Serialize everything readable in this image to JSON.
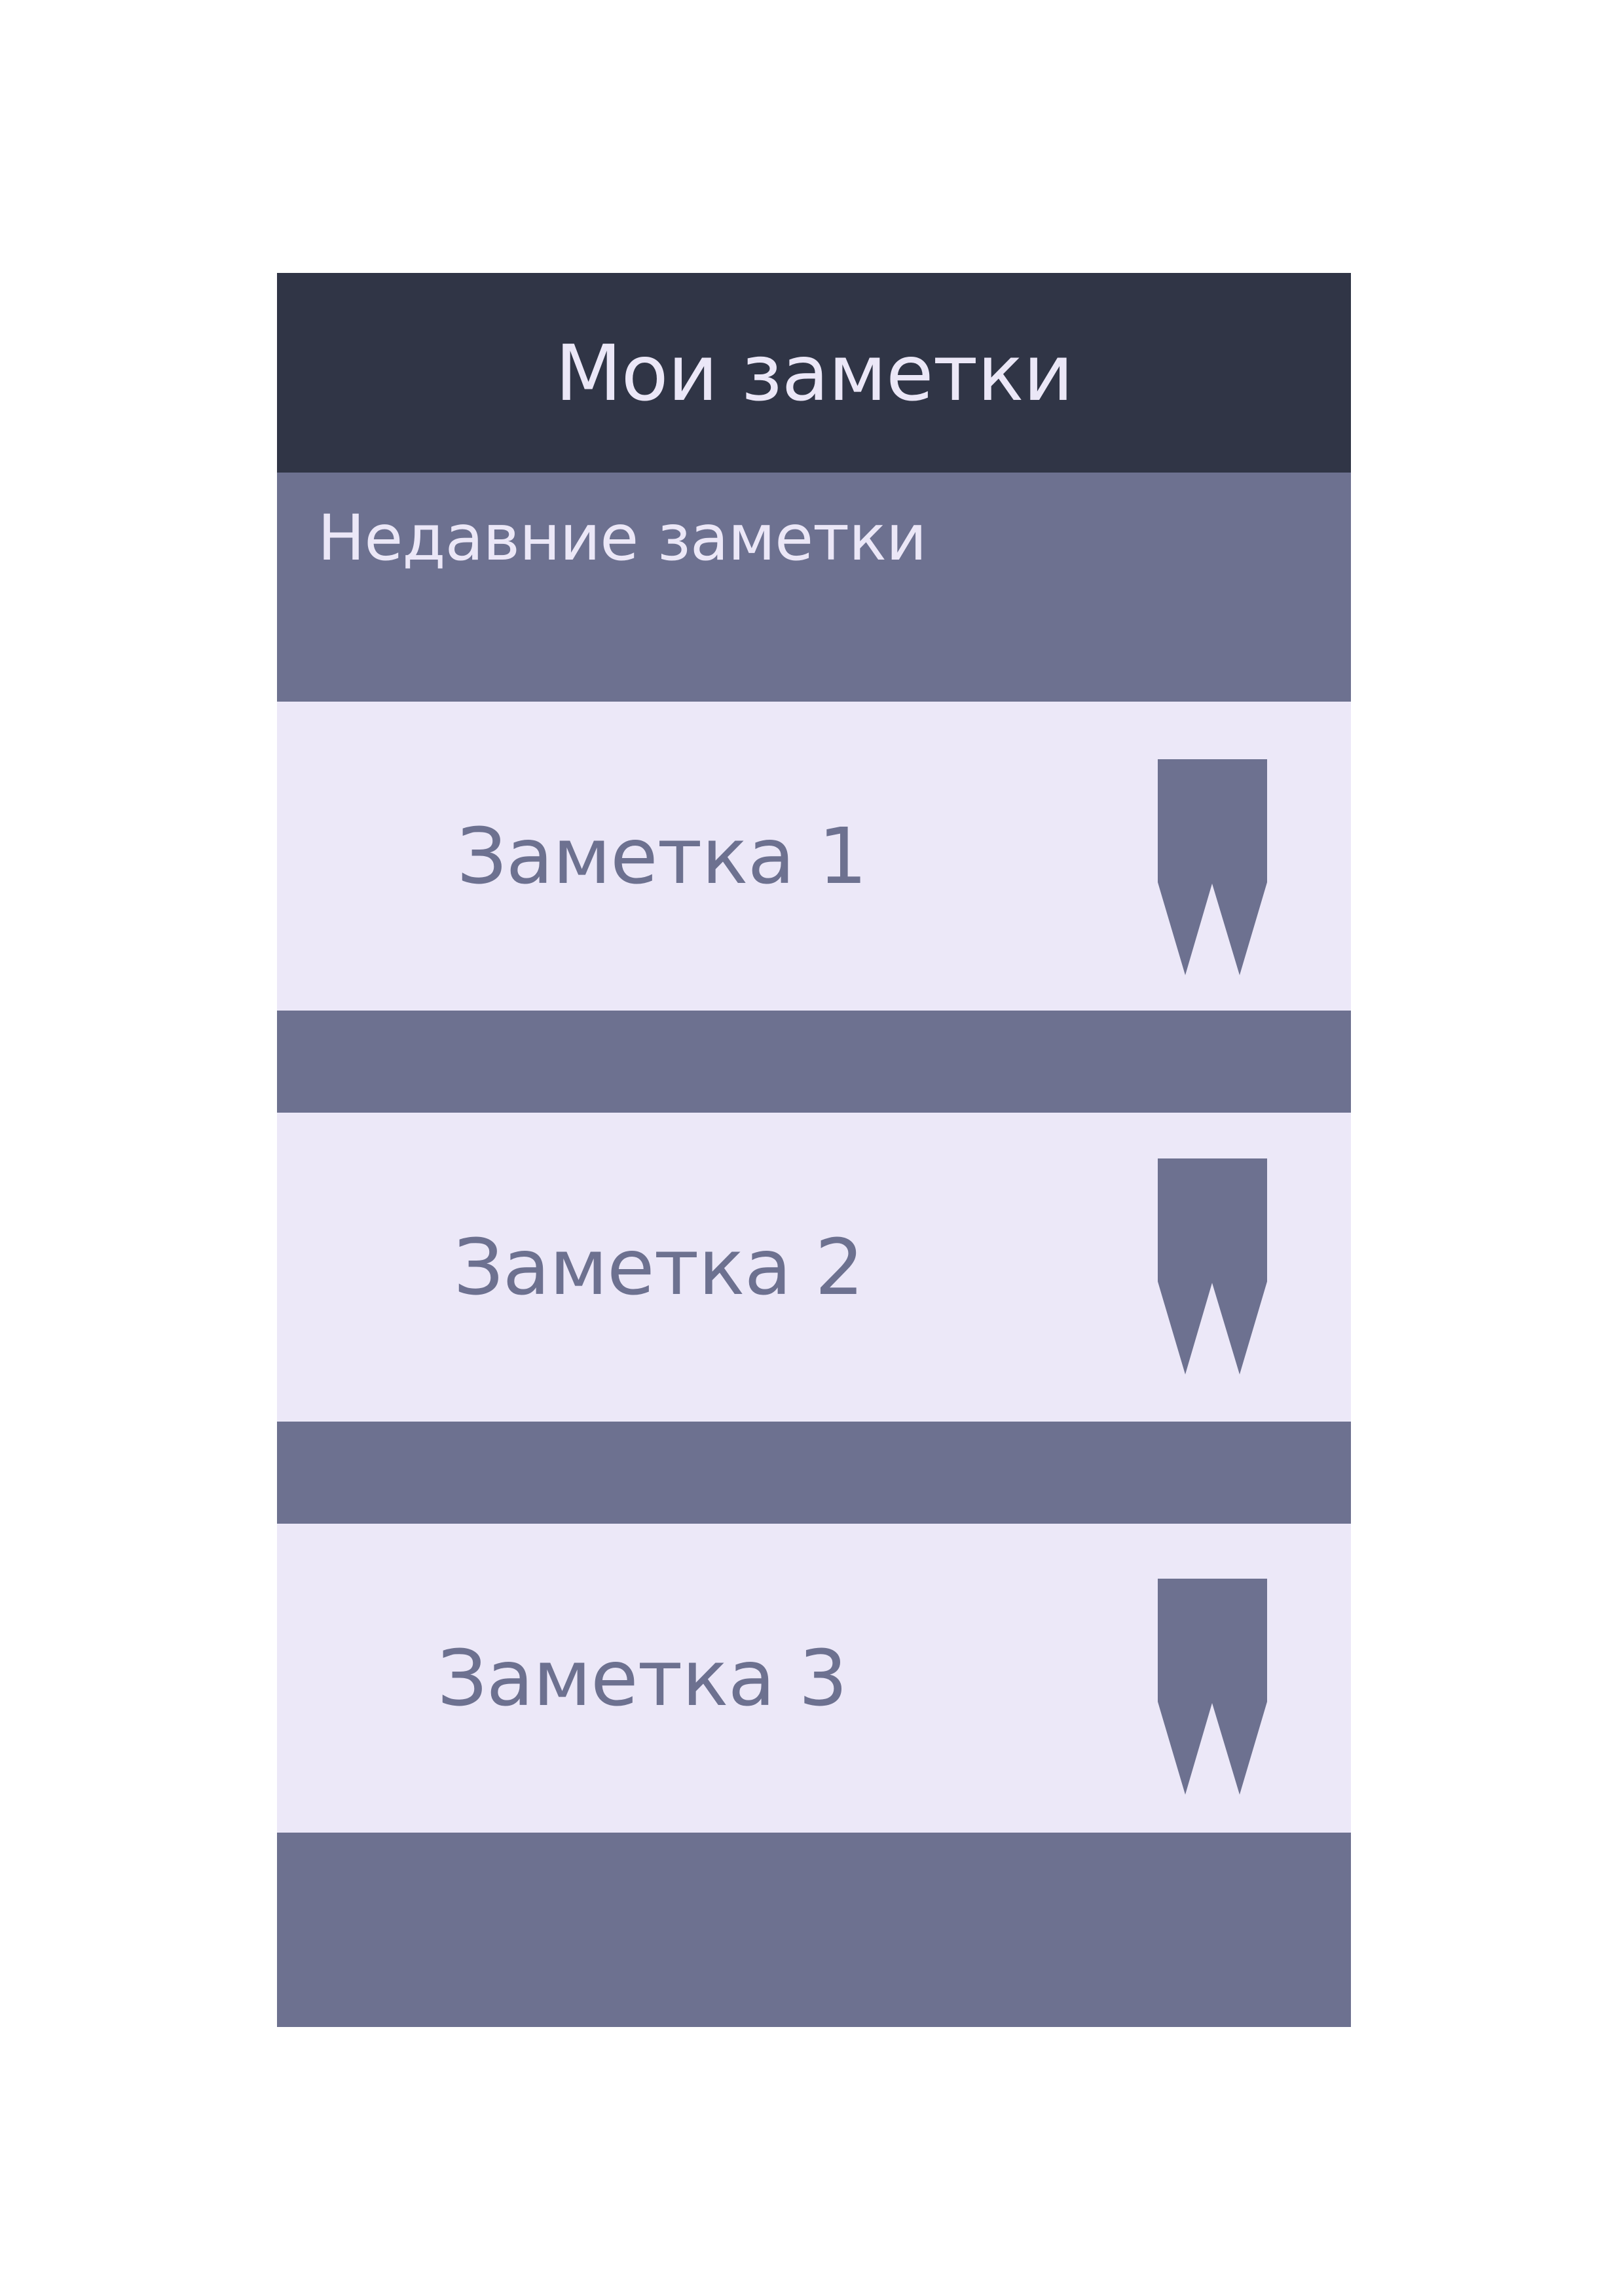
{
  "header": {
    "title": "Мои заметки"
  },
  "section": {
    "title": "Недавние заметки"
  },
  "notes": [
    {
      "label": "Заметка 1",
      "icon": "bookmark-icon"
    },
    {
      "label": "Заметка 2",
      "icon": "bookmark-icon"
    },
    {
      "label": "Заметка 3",
      "icon": "bookmark-icon"
    }
  ],
  "colors": {
    "header_bg": "#303546",
    "panel_bg": "#6d7190",
    "card_bg": "#ece8f8",
    "light_text": "#ebe7f7",
    "accent": "#6d7190"
  }
}
